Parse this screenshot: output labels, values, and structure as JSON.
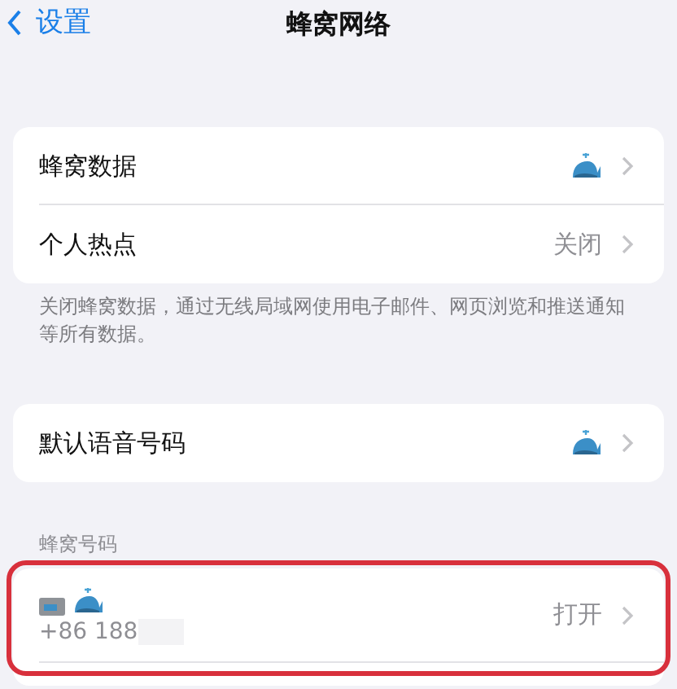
{
  "nav": {
    "back": "设置",
    "title": "蜂窝网络"
  },
  "groups": [
    {
      "rows": [
        {
          "label": "蜂窝数据",
          "kind": "icon"
        },
        {
          "label": "个人热点",
          "kind": "value",
          "value": "关闭"
        }
      ],
      "footer": "关闭蜂窝数据，通过无线局域网使用电子邮件、网页浏览和推送通知等所有数据。"
    },
    {
      "rows": [
        {
          "label": "默认语音号码",
          "kind": "icon"
        }
      ]
    },
    {
      "header": "蜂窝号码",
      "rows": [
        {
          "kind": "sim",
          "number": "+86 188",
          "redacted": true,
          "value": "打开",
          "highlighted": true
        }
      ]
    }
  ]
}
